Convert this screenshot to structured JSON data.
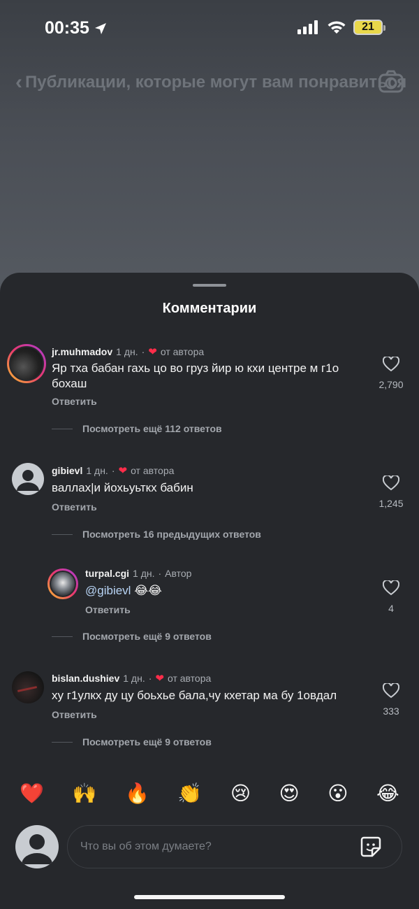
{
  "status": {
    "time": "00:35",
    "battery": "21"
  },
  "background": {
    "title": "Публикации, которые могут вам понравиться"
  },
  "sheet": {
    "title": "Комментарии"
  },
  "comments": [
    {
      "user": "jr.muhmadov",
      "age": "1 дн.",
      "sep": "·",
      "badge": "от автора",
      "text": "Яр тха бабан гахь цо во груз йир ю кхи центре м г1о бохаш",
      "reply": "Ответить",
      "likes": "2,790",
      "more": "Посмотреть ещё 112 ответов"
    },
    {
      "user": "gibievl",
      "age": "1 дн.",
      "sep": "·",
      "badge": "от автора",
      "text": "валлах|и йохьуьткх бабин",
      "reply": "Ответить",
      "likes": "1,245",
      "more": "Посмотреть 16 предыдущих ответов"
    },
    {
      "user": "turpal.cgi",
      "age": "1 дн.",
      "sep": "·",
      "badge": "Автор",
      "mention": "@gibievl",
      "text": "😂😂",
      "reply": "Ответить",
      "likes": "4",
      "more": "Посмотреть ещё 9 ответов"
    },
    {
      "user": "bislan.dushiev",
      "age": "1 дн.",
      "sep": "·",
      "badge": "от автора",
      "text": "ху г1улкх ду цу боьхье бала,чу кхетар ма бу 1овдал",
      "reply": "Ответить",
      "likes": "333",
      "more": "Посмотреть ещё 9 ответов"
    }
  ],
  "emojis": [
    "❤️",
    "🙌",
    "🔥",
    "👏",
    "😢",
    "😍",
    "😮",
    "😂"
  ],
  "composer": {
    "placeholder": "Что вы об этом думаете?"
  },
  "icons": {
    "location": "location-arrow-icon",
    "signal": "signal-icon",
    "wifi": "wifi-icon",
    "back": "back-chevron-icon",
    "camera": "camera-icon",
    "heart": "heart-outline-icon",
    "sticker": "sticker-icon"
  }
}
